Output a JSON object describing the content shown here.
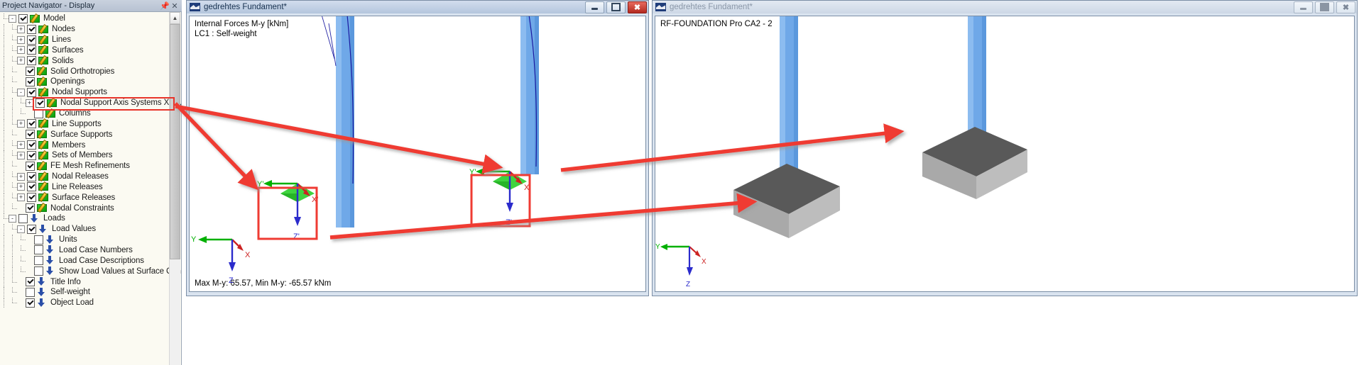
{
  "navigator": {
    "title": "Project Navigator - Display",
    "pin_icon": "pin-icon",
    "close_icon": "close-icon",
    "tree": [
      {
        "label": "Model",
        "depth": 0,
        "expander": "-",
        "checked": true,
        "icon": "pen",
        "highlight": false
      },
      {
        "label": "Nodes",
        "depth": 1,
        "expander": "+",
        "checked": true,
        "icon": "pen",
        "highlight": false
      },
      {
        "label": "Lines",
        "depth": 1,
        "expander": "+",
        "checked": true,
        "icon": "pen",
        "highlight": false
      },
      {
        "label": "Surfaces",
        "depth": 1,
        "expander": "+",
        "checked": true,
        "icon": "pen",
        "highlight": false
      },
      {
        "label": "Solids",
        "depth": 1,
        "expander": "+",
        "checked": true,
        "icon": "pen",
        "highlight": false
      },
      {
        "label": "Solid Orthotropies",
        "depth": 1,
        "expander": "",
        "checked": true,
        "icon": "pen",
        "highlight": false
      },
      {
        "label": "Openings",
        "depth": 1,
        "expander": "",
        "checked": true,
        "icon": "pen",
        "highlight": false
      },
      {
        "label": "Nodal Supports",
        "depth": 1,
        "expander": "-",
        "checked": true,
        "icon": "pen",
        "highlight": false
      },
      {
        "label": "Nodal Support Axis Systems X',Y',Z'",
        "depth": 2,
        "expander": "+",
        "checked": true,
        "icon": "pen",
        "highlight": true
      },
      {
        "label": "Columns",
        "depth": 2,
        "expander": "",
        "checked": false,
        "icon": "pen",
        "highlight": false
      },
      {
        "label": "Line Supports",
        "depth": 1,
        "expander": "+",
        "checked": true,
        "icon": "pen",
        "highlight": false
      },
      {
        "label": "Surface Supports",
        "depth": 1,
        "expander": "",
        "checked": true,
        "icon": "pen",
        "highlight": false
      },
      {
        "label": "Members",
        "depth": 1,
        "expander": "+",
        "checked": true,
        "icon": "pen",
        "highlight": false
      },
      {
        "label": "Sets of Members",
        "depth": 1,
        "expander": "+",
        "checked": true,
        "icon": "pen",
        "highlight": false
      },
      {
        "label": "FE Mesh Refinements",
        "depth": 1,
        "expander": "",
        "checked": true,
        "icon": "pen",
        "highlight": false
      },
      {
        "label": "Nodal Releases",
        "depth": 1,
        "expander": "+",
        "checked": true,
        "icon": "pen",
        "highlight": false
      },
      {
        "label": "Line Releases",
        "depth": 1,
        "expander": "+",
        "checked": true,
        "icon": "pen",
        "highlight": false
      },
      {
        "label": "Surface Releases",
        "depth": 1,
        "expander": "+",
        "checked": true,
        "icon": "pen",
        "highlight": false
      },
      {
        "label": "Nodal Constraints",
        "depth": 1,
        "expander": "",
        "checked": true,
        "icon": "pen",
        "highlight": false
      },
      {
        "label": "Loads",
        "depth": 0,
        "expander": "-",
        "checked": false,
        "icon": "arr",
        "highlight": false
      },
      {
        "label": "Load Values",
        "depth": 1,
        "expander": "-",
        "checked": true,
        "icon": "arr",
        "highlight": false
      },
      {
        "label": "Units",
        "depth": 2,
        "expander": "",
        "checked": false,
        "icon": "arr",
        "highlight": false
      },
      {
        "label": "Load Case Numbers",
        "depth": 2,
        "expander": "",
        "checked": false,
        "icon": "arr",
        "highlight": false
      },
      {
        "label": "Load Case Descriptions",
        "depth": 2,
        "expander": "",
        "checked": false,
        "icon": "arr",
        "highlight": false
      },
      {
        "label": "Show Load Values at Surface Center",
        "depth": 2,
        "expander": "",
        "checked": false,
        "icon": "arr",
        "highlight": false
      },
      {
        "label": "Title Info",
        "depth": 1,
        "expander": "",
        "checked": true,
        "icon": "arr",
        "highlight": false
      },
      {
        "label": "Self-weight",
        "depth": 1,
        "expander": "",
        "checked": false,
        "icon": "arr",
        "highlight": false
      },
      {
        "label": "Object Load",
        "depth": 1,
        "expander": "",
        "checked": true,
        "icon": "arr",
        "highlight": false
      }
    ],
    "scroll_up_icon": "chevron-up-icon"
  },
  "windows": [
    {
      "id": "left",
      "title": "gedrehtes Fundament*",
      "active": true,
      "app_icon": "rfem-app-icon",
      "minimize_icon": "minimize-icon",
      "maximize_icon": "maximize-icon",
      "close_icon": "close-icon",
      "overlay": {
        "result_caption": "Internal Forces M-y [kNm]",
        "load_case": "LC1 : Self-weight",
        "status": "Max M-y: 65.57, Min M-y: -65.57 kNm",
        "global_axes": {
          "x": "X",
          "y": "Y",
          "z": "Z"
        },
        "local_axes": {
          "x": "X'",
          "y": "Y'",
          "z": "Z'"
        }
      }
    },
    {
      "id": "right",
      "title": "gedrehtes Fundament*",
      "active": false,
      "app_icon": "rfem-app-icon",
      "minimize_icon": "minimize-icon",
      "maximize_icon": "maximize-icon",
      "close_icon": "close-icon",
      "overlay": {
        "result_caption": "RF-FOUNDATION Pro CA2 - 2",
        "global_axes": {
          "x": "X",
          "y": "Y",
          "z": "Z"
        }
      }
    }
  ],
  "colors": {
    "annotation_red": "#ef3b33",
    "axis_x": "#cc2222",
    "axis_y": "#00b000",
    "axis_z": "#2b2bcc",
    "column_blue": "#6fa8e8",
    "foundation_gray": "#a9a9a9",
    "highlight_border": "#e8342a"
  }
}
